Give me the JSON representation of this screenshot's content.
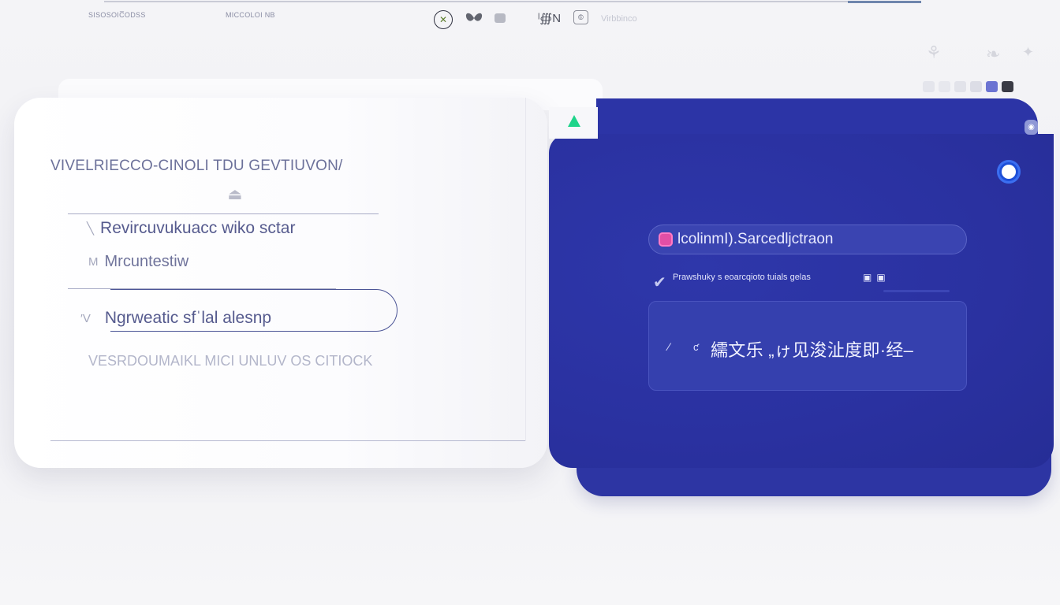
{
  "topbar": {
    "label_left": "SISOSOIC̅ODSS",
    "label_mid": "MICCOLOI NB",
    "hint": "Virbbinco",
    "progress": 0.09
  },
  "colors": {
    "swatches": [
      "#e4e5ec",
      "#e7e8ee",
      "#e2e3ea",
      "#dcdde6",
      "#6c74d2",
      "#3a3b45"
    ],
    "panel_accent": "#2c34a6",
    "green_marker": "#1ed48a"
  },
  "left_card": {
    "heading": "VIVELRIECCO-CINOLI TDU GEVTIUVON/",
    "options": [
      {
        "mark": "╲",
        "label": "Revircuvukuacc wiko sctar"
      },
      {
        "mark": "M",
        "label": "Mrcuntestiw"
      },
      {
        "mark": "′V",
        "label": "Ngrweatic sfˈlal alesnp"
      }
    ],
    "footer_note": "VESRDOUMAIKL MICI UNLUV OS CITIOCK"
  },
  "right_panel": {
    "search_value": "lcolinmӀ).Sarcedljctraon",
    "hint": "Prawshuky s eoarcqioto  tuials  gelas",
    "hint_icons": "▣▣",
    "result_mark1": "⁄",
    "result_mark2": "ƈ",
    "result_text": "繻文乐 „ゖ见浚沚度即·经–"
  },
  "icons": {
    "tool1": "✕",
    "tool4": "ˡ∰N",
    "tool5": "©",
    "caret": "⏏",
    "check": "✔",
    "ghost1": "⚘",
    "ghost2": "❧",
    "ghost3": "✦"
  }
}
